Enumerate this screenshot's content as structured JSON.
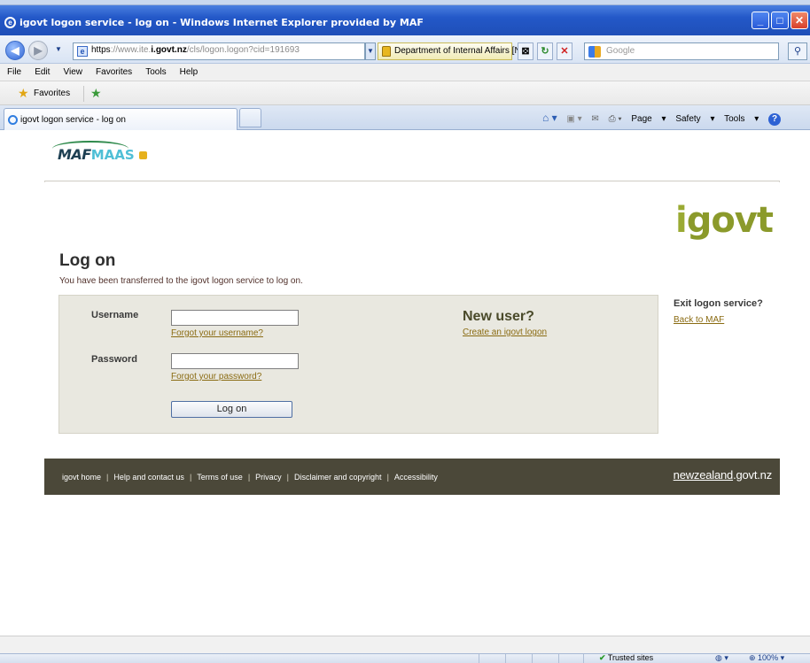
{
  "browser": {
    "window_title": "igovt logon service - log on - Windows Internet Explorer provided by MAF",
    "address": {
      "scheme": "https",
      "prefix_grey": "://www.ite.",
      "domain": "i.govt.nz",
      "path_grey": "/cls/logon.logon?cid=191693"
    },
    "security_label": "Department of Internal Affairs [NZ]",
    "search_placeholder": "Google",
    "menu": [
      "File",
      "Edit",
      "View",
      "Favorites",
      "Tools",
      "Help"
    ],
    "favorites_label": "Favorites",
    "tab_title": "igovt logon service - log on",
    "command_bar": {
      "page": "Page",
      "safety": "Safety",
      "tools": "Tools"
    },
    "status": {
      "zone": "Trusted sites",
      "zoom": "100%"
    }
  },
  "page": {
    "logo": {
      "maf": "MAF",
      "maas": "MAAS"
    },
    "brand": {
      "i": "i",
      "rest": "govt"
    },
    "title": "Log on",
    "subtitle": "You have been transferred to the igovt logon service to log on.",
    "form": {
      "username_label": "Username",
      "username_value": "",
      "forgot_username": "Forgot your username?",
      "password_label": "Password",
      "password_value": "",
      "forgot_password": "Forgot your password?",
      "submit_label": "Log on"
    },
    "new_user": {
      "title": "New user?",
      "link": "Create an igovt logon"
    },
    "exit": {
      "title": "Exit logon service?",
      "link": "Back to MAF"
    },
    "footer": {
      "links": [
        "igovt home",
        "Help and contact us",
        "Terms of use",
        "Privacy",
        "Disclaimer and copyright",
        "Accessibility"
      ],
      "nz_a": "newzealand",
      "nz_b": ".govt.nz"
    }
  },
  "colors": {
    "titlebar": "#2358c8",
    "brand_green": "#8b9a2b",
    "footer_bg": "#4b4839",
    "link": "#8a6b12",
    "panel_bg": "#e9e8e0"
  }
}
